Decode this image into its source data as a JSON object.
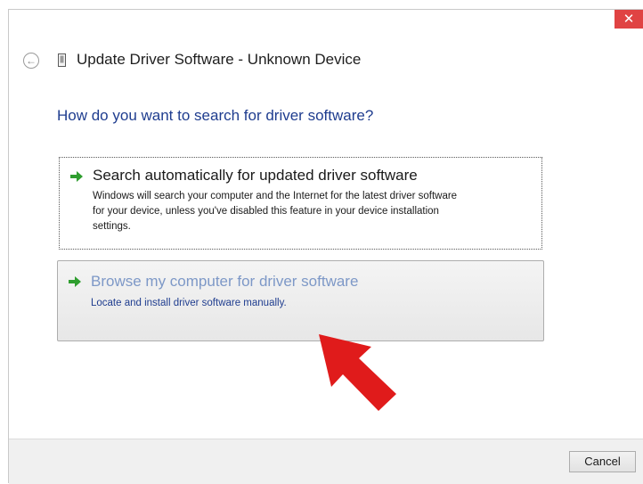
{
  "window": {
    "close_label": "✕",
    "back_icon": "back-arrow-icon",
    "device_icon": "device-icon",
    "title": "Update Driver Software - Unknown Device"
  },
  "main": {
    "question": "How do you want to search for driver software?",
    "options": [
      {
        "icon": "green-arrow-icon",
        "title": "Search automatically for updated driver software",
        "desc_lines": [
          "Windows will search your computer and the Internet for the latest driver software",
          "for your device, unless you've disabled this feature in your device installation",
          "settings."
        ]
      },
      {
        "icon": "green-arrow-icon",
        "title": "Browse my computer for driver software",
        "desc_lines": [
          "Locate and install driver software manually."
        ]
      }
    ]
  },
  "footer": {
    "cancel_label": "Cancel"
  },
  "annotation": {
    "icon": "red-pointer-arrow-icon",
    "color": "#e01b1b"
  },
  "colors": {
    "heading_blue": "#1f3d8f",
    "hover_title": "#7d98c7",
    "close_red": "#e04343"
  }
}
